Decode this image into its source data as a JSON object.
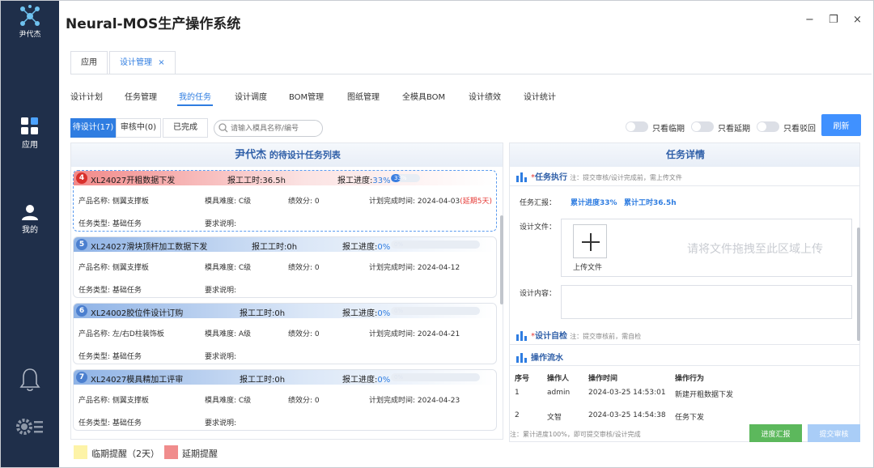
{
  "app": {
    "title": "Neural-MOS生产操作系统"
  },
  "sidebar": {
    "user_label": "尹代杰",
    "items": [
      {
        "label": "应用",
        "icon": "grid-icon"
      },
      {
        "label": "我的",
        "icon": "person-icon"
      }
    ],
    "bottom_icons": [
      "bell-icon",
      "settings-icon"
    ]
  },
  "window": {
    "minimize": "−",
    "restore": "❐",
    "close": "×"
  },
  "doc_tabs": [
    {
      "label": "应用",
      "active": false
    },
    {
      "label": "设计管理",
      "active": true,
      "close": "×"
    }
  ],
  "subnav": [
    "设计计划",
    "任务管理",
    "我的任务",
    "设计调度",
    "BOM管理",
    "图纸管理",
    "全模具BOM",
    "设计绩效",
    "设计统计"
  ],
  "filters": {
    "tabs": [
      "待设计(17)",
      "审核中(0)",
      "已完成"
    ],
    "search_placeholder": "请输入模具名称/编号",
    "toggles": [
      "只看临期",
      "只看延期",
      "只看驳回"
    ],
    "refresh": "刷新"
  },
  "left": {
    "header_name": "尹代杰",
    "header_suffix": " 的待设计任务列表",
    "cards": [
      {
        "num": "4",
        "id": "XL24027开粗数据下发",
        "hours": "报工工时:36.5h",
        "progress_label": "报工进度:",
        "progress": "33%",
        "progress_frac": 0.33,
        "product": "产品名称: 侧翼支撑板",
        "difficulty": "模具难度: C级",
        "score": "绩效分: 0",
        "planned": "计划完成时间: 2024-04-03",
        "overdue": "(延期5天)",
        "type": "任务类型: 基础任务",
        "req": "要求说明:",
        "status": "overdue"
      },
      {
        "num": "5",
        "id": "XL24027滑块顶杆加工数据下发",
        "hours": "报工工时:0h",
        "progress_label": "报工进度:",
        "progress": "0%",
        "progress_frac": 0,
        "product": "产品名称: 侧翼支撑板",
        "difficulty": "模具难度: C级",
        "score": "绩效分: 0",
        "planned": "计划完成时间: 2024-04-12",
        "overdue": "",
        "type": "任务类型: 基础任务",
        "req": "要求说明:",
        "status": "normal"
      },
      {
        "num": "6",
        "id": "XL24002胶位件设计订购",
        "hours": "报工工时:0h",
        "progress_label": "报工进度:",
        "progress": "0%",
        "progress_frac": 0,
        "product": "产品名称: 左/右D柱装饰板",
        "difficulty": "模具难度: A级",
        "score": "绩效分: 0",
        "planned": "计划完成时间: 2024-04-21",
        "overdue": "",
        "type": "任务类型: 基础任务",
        "req": "要求说明:",
        "status": "normal"
      },
      {
        "num": "7",
        "id": "XL24027模具精加工评审",
        "hours": "报工工时:0h",
        "progress_label": "报工进度:",
        "progress": "0%",
        "progress_frac": 0,
        "product": "产品名称: 侧翼支撑板",
        "difficulty": "模具难度: C级",
        "score": "绩效分: 0",
        "planned": "计划完成时间: 2024-04-23",
        "overdue": "",
        "type": "任务类型: 基础任务",
        "req": "要求说明:",
        "status": "normal"
      }
    ]
  },
  "legend": [
    {
      "label": "临期提醒（2天）",
      "color": "#fdf3a7"
    },
    {
      "label": "延期提醒",
      "color": "#f08c8c"
    }
  ],
  "right": {
    "header": "任务详情",
    "exec_title": "任务执行",
    "exec_note": "注：提交审核/设计完成前，需上传文件",
    "report_label": "任务汇报：",
    "report_progress": "累计进度33%",
    "report_hours": "累计工时36.5h",
    "file_label": "设计文件：",
    "upload_label": "上传文件",
    "upload_hint": "请将文件拖拽至此区域上传",
    "content_label": "设计内容：",
    "self_check_title": "设计自检",
    "self_check_note": "注：提交审核前，需自检",
    "log_title": "操作流水",
    "log_headers": [
      "序号",
      "操作人",
      "操作时间",
      "操作行为"
    ],
    "log_rows": [
      [
        "1",
        "admin",
        "2024-03-25 14:53:01",
        "新建开粗数据下发"
      ],
      [
        "2",
        "文智",
        "2024-03-25 14:54:38",
        "任务下发"
      ]
    ],
    "bottom_note": "注：累计进度100%，即可提交审核/设计完成",
    "btn_report": "进度汇报",
    "btn_submit": "提交审核"
  }
}
